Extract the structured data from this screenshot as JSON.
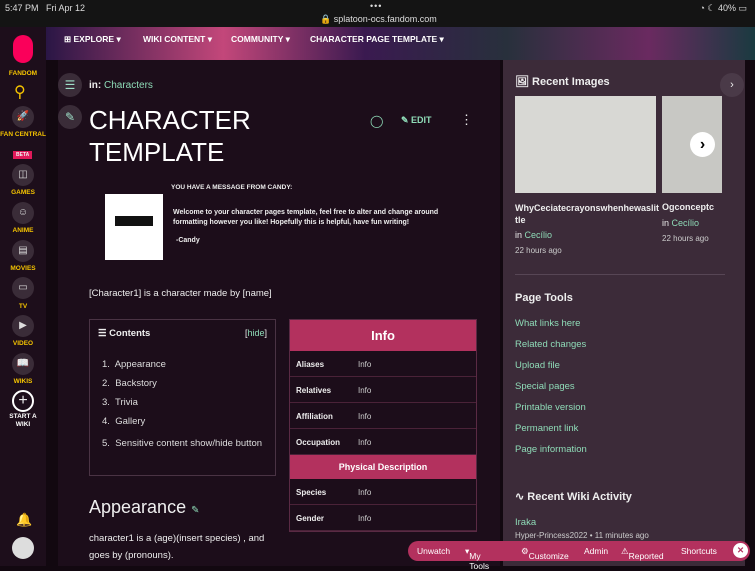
{
  "status": {
    "time": "5:47 PM",
    "date": "Fri Apr 12",
    "url": "splatoon-ocs.fandom.com",
    "battery": "40%"
  },
  "nav": [
    "EXPLORE",
    "WIKI CONTENT",
    "COMMUNITY",
    "CHARACTER PAGE TEMPLATE"
  ],
  "sidebar": {
    "brand": "FANDOM",
    "items": [
      "FAN CENTRAL",
      "GAMES",
      "ANIME",
      "MOVIES",
      "TV",
      "VIDEO",
      "WIKIS",
      "START A WIKI"
    ],
    "beta": "BETA"
  },
  "page": {
    "in_label": "in:",
    "category": "Characters",
    "title_line1": "CHARACTER",
    "title_line2": "TEMPLATE",
    "edit": "EDIT",
    "message_header": "YOU HAVE A MESSAGE FROM CANDY:",
    "message_body": "Welcome to your character pages template, feel free to alter and change around formatting however you like! Hopefully this is helpful, have fun writing!",
    "message_sign": "-Candy",
    "intro": "[Character1] is a character made by [name]",
    "section": "Appearance",
    "section_text": "character1 is a (age)(insert species) , and goes by (pronouns)."
  },
  "toc": {
    "title": "Contents",
    "hide": "hide",
    "items": [
      "Appearance",
      "Backstory",
      "Trivia",
      "Gallery",
      "Sensitive content show/hide button"
    ]
  },
  "infobox": {
    "title": "Info",
    "rows": [
      [
        "Aliases",
        "Info"
      ],
      [
        "Relatives",
        "Info"
      ],
      [
        "Affiliation",
        "Info"
      ],
      [
        "Occupation",
        "Info"
      ]
    ],
    "subheader": "Physical Description",
    "rows2": [
      [
        "Species",
        "Info"
      ],
      [
        "Gender",
        "Info"
      ]
    ]
  },
  "rail": {
    "recent_images": "Recent Images",
    "images": [
      {
        "title": "WhyCeciatecrayonswhenhewaslittle",
        "in": "in",
        "where": "Cecílio",
        "time": "22 hours ago"
      },
      {
        "title": "Ogconceptc",
        "in": "in",
        "where": "Cecílio",
        "time": "22 hours ago"
      }
    ],
    "page_tools": "Page Tools",
    "tools": [
      "What links here",
      "Related changes",
      "Upload file",
      "Special pages",
      "Printable version",
      "Permanent link",
      "Page information"
    ],
    "activity": "Recent Wiki Activity",
    "act_page": "Iraka",
    "act_meta": "Hyper-Princess2022 • 11 minutes ago"
  },
  "toolbar": [
    "Unwatch",
    "My Tools",
    "Customize",
    "Admin",
    "Reported",
    "Shortcuts"
  ]
}
